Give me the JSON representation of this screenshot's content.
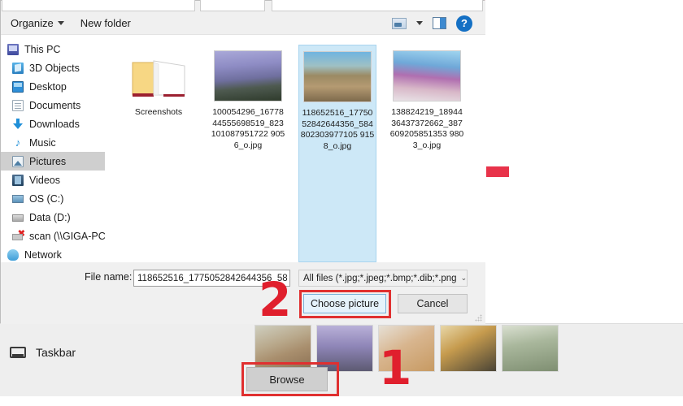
{
  "dialog": {
    "toolbar": {
      "organize_label": "Organize",
      "new_folder_label": "New folder",
      "view_icon": "view-options-icon",
      "view_caret_icon": "chevron-down-icon",
      "preview_pane_icon": "preview-pane-icon",
      "help_icon": "help-icon",
      "help_glyph": "?"
    },
    "nav_pane": {
      "items": [
        {
          "label": "This PC",
          "icon": "this-pc-icon",
          "icon_class": "i-thispc",
          "level": "root",
          "selected": false
        },
        {
          "label": "3D Objects",
          "icon": "3d-objects-icon",
          "icon_class": "i-3d",
          "level": "child",
          "selected": false
        },
        {
          "label": "Desktop",
          "icon": "desktop-icon",
          "icon_class": "i-desktop",
          "level": "child",
          "selected": false
        },
        {
          "label": "Documents",
          "icon": "documents-icon",
          "icon_class": "i-docs",
          "level": "child",
          "selected": false
        },
        {
          "label": "Downloads",
          "icon": "downloads-icon",
          "icon_class": "i-down",
          "level": "child",
          "selected": false
        },
        {
          "label": "Music",
          "icon": "music-icon",
          "icon_class": "i-music",
          "level": "child",
          "selected": false
        },
        {
          "label": "Pictures",
          "icon": "pictures-icon",
          "icon_class": "i-pics",
          "level": "child",
          "selected": true
        },
        {
          "label": "Videos",
          "icon": "videos-icon",
          "icon_class": "i-video",
          "level": "child",
          "selected": false
        },
        {
          "label": "OS (C:)",
          "icon": "os-drive-icon",
          "icon_class": "i-os",
          "level": "child",
          "selected": false
        },
        {
          "label": "Data (D:)",
          "icon": "data-drive-icon",
          "icon_class": "i-data",
          "level": "child",
          "selected": false
        },
        {
          "label": "scan (\\\\GIGA-PC",
          "icon": "network-drive-disconnected-icon",
          "icon_class": "i-scan",
          "level": "child",
          "selected": false
        },
        {
          "label": "Network",
          "icon": "network-icon",
          "icon_class": "i-net",
          "level": "root",
          "selected": false
        }
      ],
      "scroll_up_glyph": "∧",
      "scroll_down_glyph": "∨"
    },
    "files": [
      {
        "name": "Screenshots",
        "type": "folder",
        "selected": false
      },
      {
        "name": "100054296_1677844555698519_823101087951722 9056_o.jpg",
        "type": "image",
        "selected": false
      },
      {
        "name": "118652516_1775052842644356_584802303977105 9158_o.jpg",
        "type": "image",
        "selected": true
      },
      {
        "name": "138824219_1894436437372662_387609205851353 9803_o.jpg",
        "type": "image",
        "selected": false
      }
    ],
    "footer": {
      "file_name_label": "File name:",
      "file_name_value": "118652516_1775052842644356_58",
      "file_type_value": "All files (*.jpg;*.jpeg;*.bmp;*.dib;*.png",
      "choose_label": "Choose picture",
      "cancel_label": "Cancel",
      "dropdown_glyph": "⌄"
    }
  },
  "background": {
    "taskbar_label": "Taskbar",
    "taskbar_icon": "taskbar-icon",
    "browse_label": "Browse",
    "thumbnail_count": 5
  },
  "callouts": [
    {
      "number": "2",
      "target": "choose-picture-button"
    },
    {
      "number": "1",
      "target": "browse-button"
    }
  ],
  "colors": {
    "callout_red": "#e01f2d",
    "highlight_box_red": "#e03030",
    "selection_blue": "#cde8f7",
    "accent_bar": "#e8334a"
  }
}
